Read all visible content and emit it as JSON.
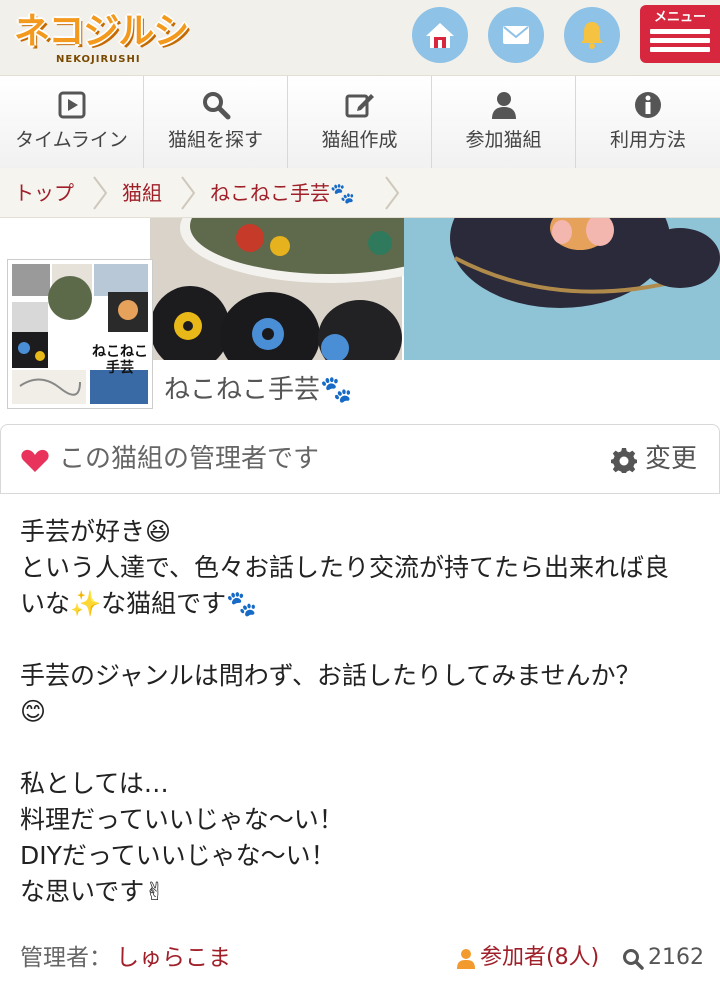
{
  "header": {
    "logo_text": "ネコジルシ",
    "logo_sub": "NEKOJIRUSHI",
    "menu_label": "メニュー"
  },
  "nav": [
    {
      "label": "タイムライン",
      "icon": "play-icon"
    },
    {
      "label": "猫組を探す",
      "icon": "search-icon"
    },
    {
      "label": "猫組作成",
      "icon": "edit-icon"
    },
    {
      "label": "参加猫組",
      "icon": "user-icon"
    },
    {
      "label": "利用方法",
      "icon": "info-icon"
    }
  ],
  "breadcrumb": [
    "トップ",
    "猫組",
    "ねこねこ手芸🐾"
  ],
  "group": {
    "title": "ねこねこ手芸🐾",
    "thumb_text_1": "ねこねこ",
    "thumb_text_2": "手芸"
  },
  "admin_bar": {
    "text": "この猫組の管理者です",
    "change": "変更"
  },
  "description": [
    "手芸が好き😆",
    "という人達で、色々お話したり交流が持てたら出来れば良",
    "いな✨な猫組です🐾",
    "",
    "手芸のジャンルは問わず、お話したりしてみませんか？",
    "😊",
    "",
    "私としては…",
    "料理だっていいじゃな〜い！",
    "DIYだっていいじゃな〜い！",
    "な思いです✌"
  ],
  "footer": {
    "admin_label": "管理者：",
    "admin_name": "しゅらこま",
    "members": "参加者(8人)",
    "views": "2162"
  },
  "colors": {
    "accent_red": "#d6273f",
    "link_red": "#a0202a",
    "icon_blue": "#8ec2e6",
    "logo_orange": "#f39a1e"
  }
}
